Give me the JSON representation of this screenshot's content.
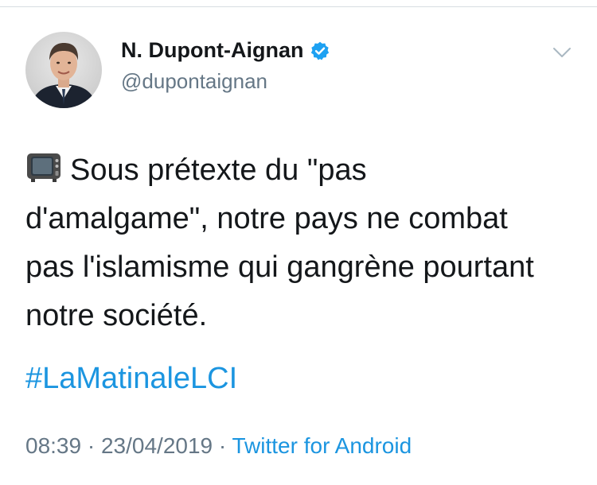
{
  "author": {
    "display_name": "N. Dupont-Aignan",
    "handle": "@dupontaignan",
    "verified": true
  },
  "tweet": {
    "emoji_icon": "television-icon",
    "lines": [
      "Sous prétexte du \"pas",
      "d'amalgame\", notre pays ne combat",
      "pas l'islamisme qui gangrène pourtant",
      "notre société."
    ],
    "hashtag": "#LaMatinaleLCI"
  },
  "meta": {
    "time": "08:39",
    "separator_1": " · ",
    "date": "23/04/2019",
    "separator_2": " · ",
    "source": "Twitter for Android"
  },
  "colors": {
    "link": "#1b95e0",
    "secondary_text": "#657786",
    "primary_text": "#14171a"
  }
}
